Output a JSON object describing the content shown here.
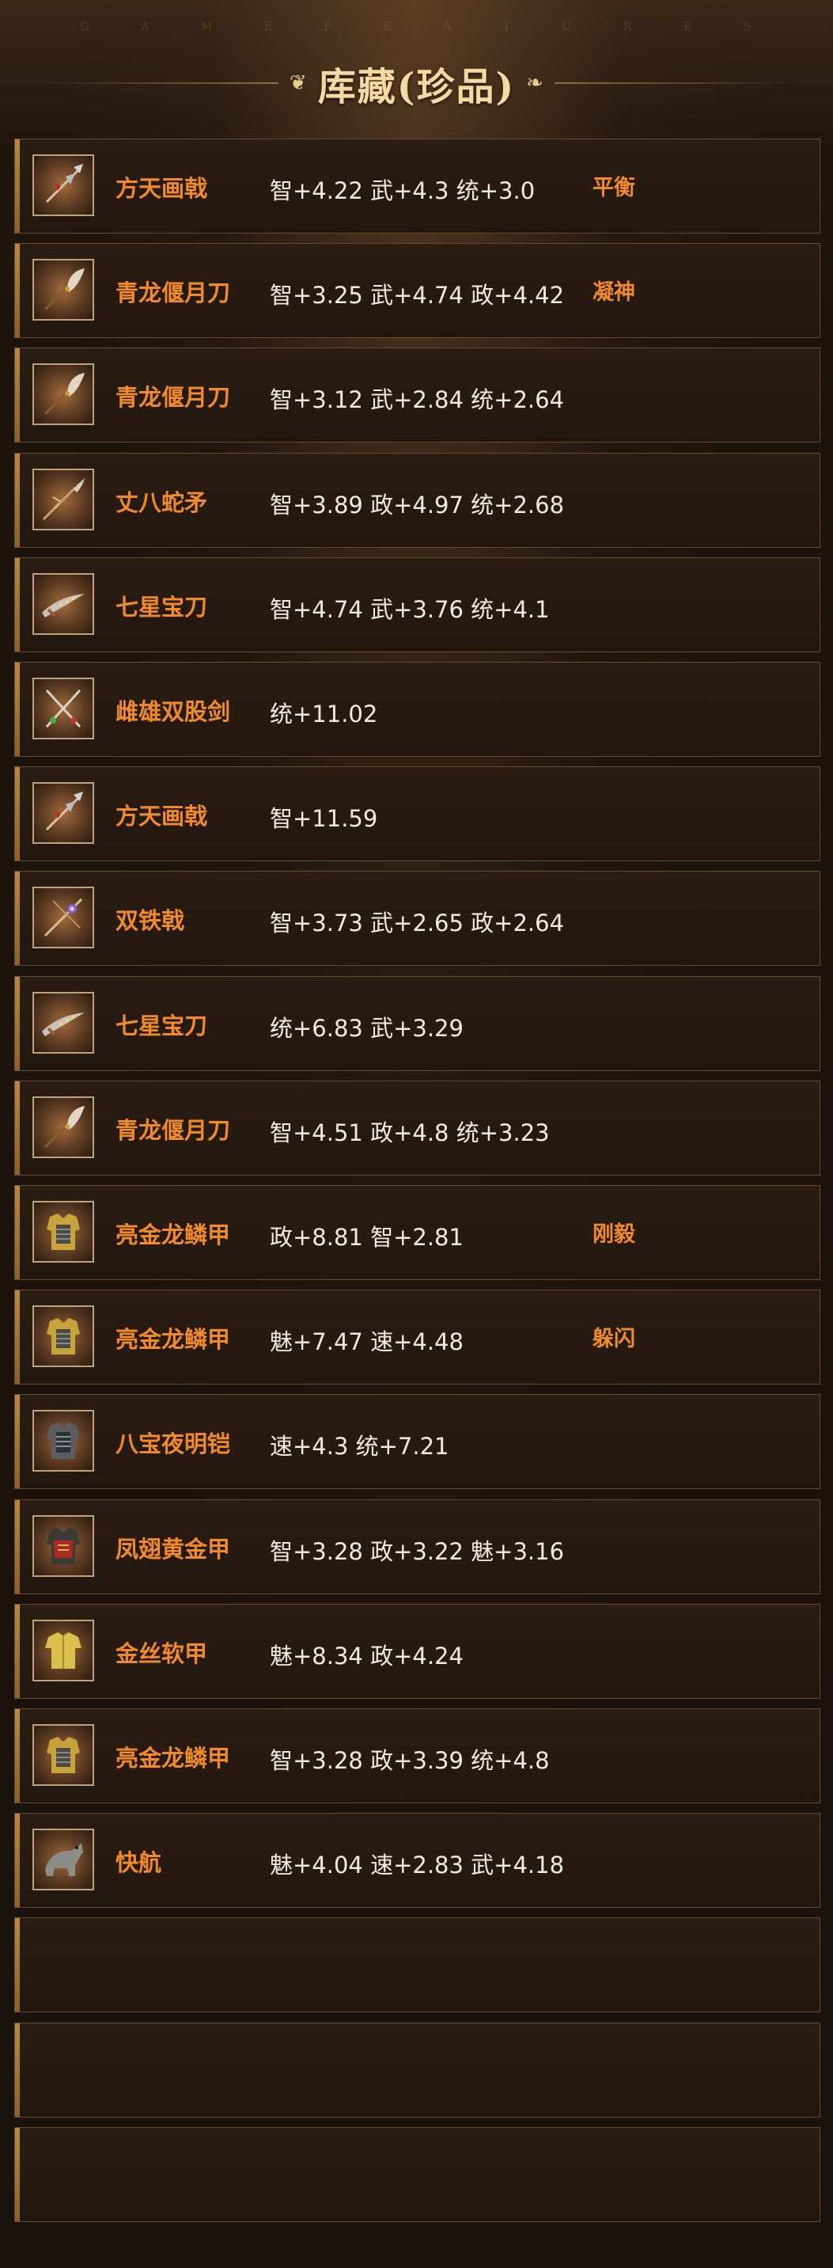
{
  "header": {
    "watermark": [
      "G",
      "A",
      "M",
      "E",
      "F",
      "E",
      "A",
      "T",
      "U",
      "R",
      "E",
      "S"
    ],
    "title": "库藏(珍品)"
  },
  "items": [
    {
      "name": "方天画戟",
      "stats": "智+4.22 武+4.3 统+3.0",
      "trait": "平衡",
      "icon": "halberd-icon"
    },
    {
      "name": "青龙偃月刀",
      "stats": "智+3.25 武+4.74 政+4.42",
      "trait": "凝神",
      "icon": "glaive-icon"
    },
    {
      "name": "青龙偃月刀",
      "stats": "智+3.12 武+2.84 统+2.64",
      "trait": "",
      "icon": "glaive-icon"
    },
    {
      "name": "丈八蛇矛",
      "stats": "智+3.89 政+4.97 统+2.68",
      "trait": "",
      "icon": "serpent-spear-icon"
    },
    {
      "name": "七星宝刀",
      "stats": "智+4.74 武+3.76 统+4.1",
      "trait": "",
      "icon": "seven-star-sword-icon"
    },
    {
      "name": "雌雄双股剑",
      "stats": "统+11.02",
      "trait": "",
      "icon": "twin-swords-icon"
    },
    {
      "name": "方天画戟",
      "stats": "智+11.59",
      "trait": "",
      "icon": "halberd-icon"
    },
    {
      "name": "双铁戟",
      "stats": "智+3.73 武+2.65 政+2.64",
      "trait": "",
      "icon": "twin-iron-halberd-icon"
    },
    {
      "name": "七星宝刀",
      "stats": "统+6.83 武+3.29",
      "trait": "",
      "icon": "seven-star-sword-icon"
    },
    {
      "name": "青龙偃月刀",
      "stats": "智+4.51 政+4.8 统+3.23",
      "trait": "",
      "icon": "glaive-icon"
    },
    {
      "name": "亮金龙鳞甲",
      "stats": "政+8.81 智+2.81",
      "trait": "刚毅",
      "icon": "gold-armor-icon"
    },
    {
      "name": "亮金龙鳞甲",
      "stats": "魅+7.47 速+4.48",
      "trait": "躲闪",
      "icon": "gold-armor-icon"
    },
    {
      "name": "八宝夜明铠",
      "stats": "速+4.3 统+7.21",
      "trait": "",
      "icon": "dark-armor-icon"
    },
    {
      "name": "凤翅黄金甲",
      "stats": "智+3.28 政+3.22 魅+3.16",
      "trait": "",
      "icon": "phoenix-armor-icon"
    },
    {
      "name": "金丝软甲",
      "stats": "魅+8.34 政+4.24",
      "trait": "",
      "icon": "silk-armor-icon"
    },
    {
      "name": "亮金龙鳞甲",
      "stats": "智+3.28 政+3.39 统+4.8",
      "trait": "",
      "icon": "gold-armor-icon"
    },
    {
      "name": "快航",
      "stats": "魅+4.04 速+2.83 武+4.18",
      "trait": "",
      "icon": "horse-icon"
    }
  ],
  "empty_slots": 3,
  "colors": {
    "item_name": "#f08a2a",
    "stats_text": "#f3ece2",
    "title": "#f5d9a2",
    "row_border": "#6a4a2a",
    "accent_bar": "#b8893e"
  }
}
